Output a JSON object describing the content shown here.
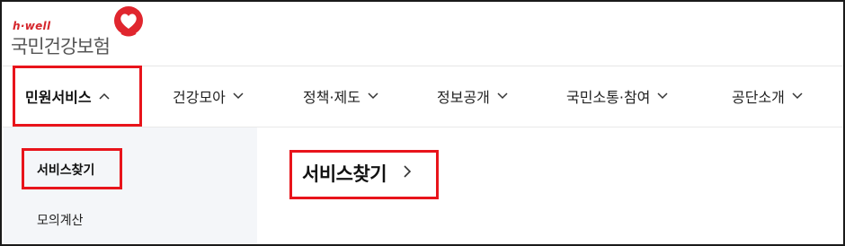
{
  "logo": {
    "brand_tag": "h·well",
    "name": "국민건강보험",
    "icon": "heart-pin-icon",
    "brand_color": "#d5262c"
  },
  "nav": {
    "items": [
      {
        "label": "민원서비스",
        "chevron": "^"
      },
      {
        "label": "건강모아",
        "chevron": "∨"
      },
      {
        "label": "정책·제도",
        "chevron": "∨"
      },
      {
        "label": "정보공개",
        "chevron": "∨"
      },
      {
        "label": "국민소통·참여",
        "chevron": "∨"
      },
      {
        "label": "공단소개",
        "chevron": "∨"
      }
    ]
  },
  "sidebar": {
    "items": [
      {
        "label": "서비스찾기"
      },
      {
        "label": "모의계산"
      }
    ]
  },
  "main": {
    "title": "서비스찾기",
    "title_chevron": ">"
  },
  "highlight_color": "#e8141b"
}
